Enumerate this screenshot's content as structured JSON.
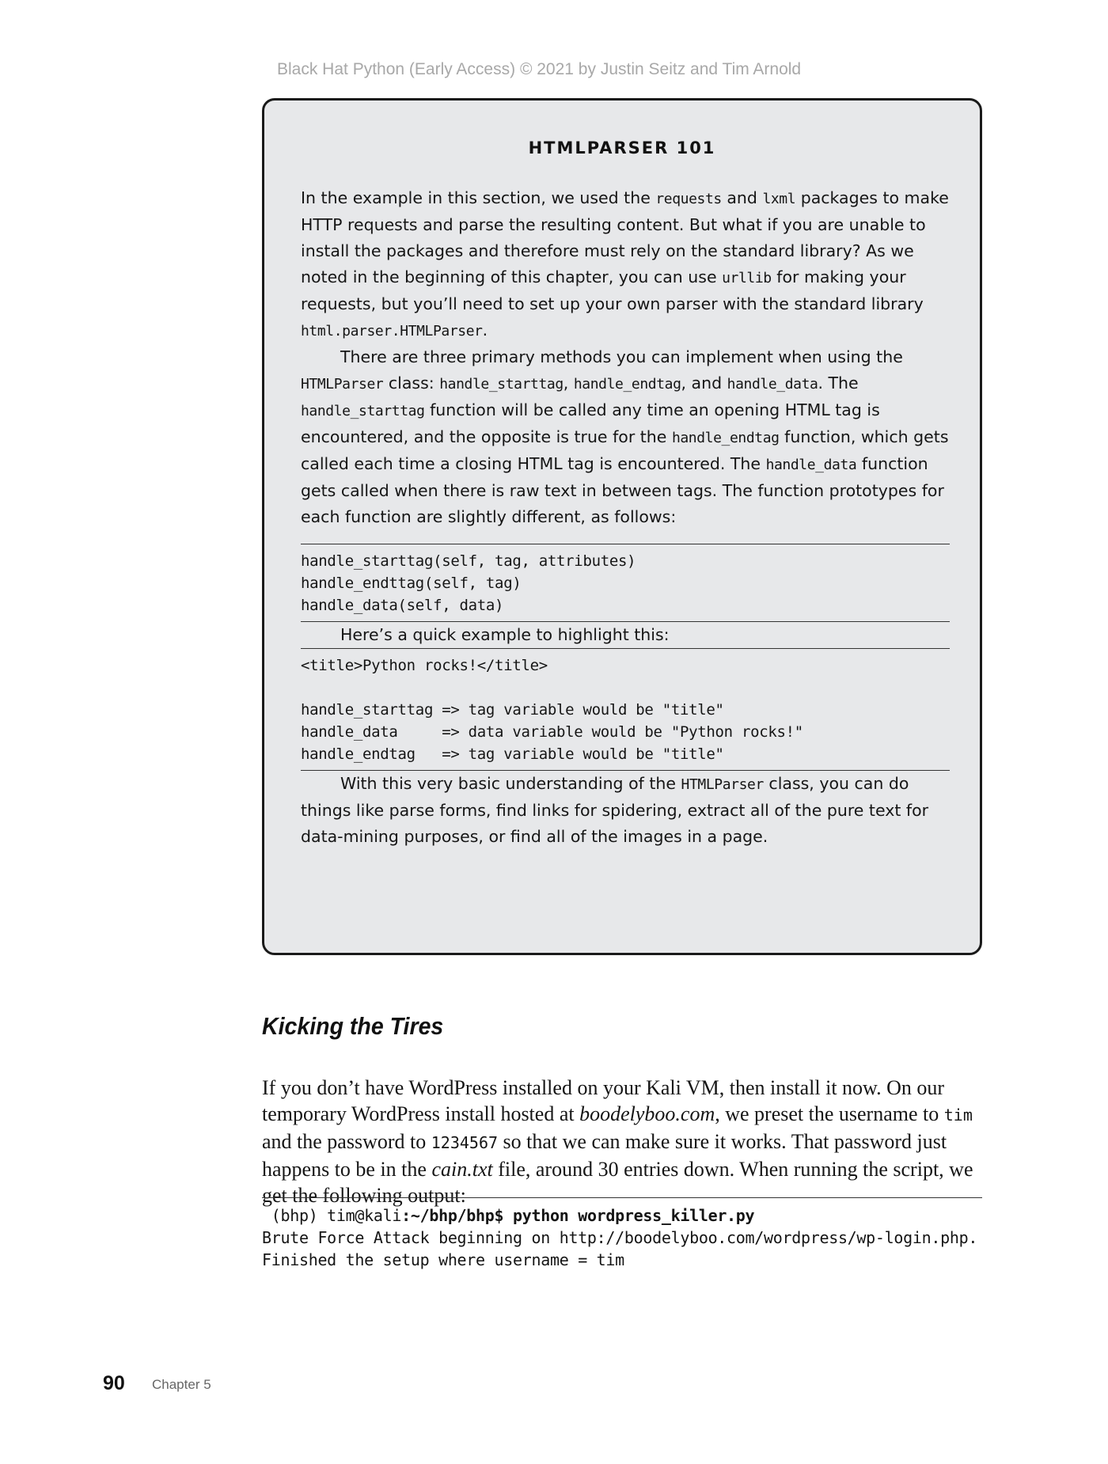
{
  "header": {
    "watermark": "Black Hat Python (Early Access) © 2021 by Justin Seitz and Tim Arnold"
  },
  "sidebar": {
    "title": "HTMLPARSER 101",
    "p1": {
      "t1": "In the example in this section, we used the ",
      "c1": "requests",
      "t2": " and ",
      "c2": "lxml",
      "t3": " packages to make HTTP requests and parse the resulting content. But what if you are unable to install the packages and therefore must rely on the standard library? As we noted in the beginning of this chapter, you can use ",
      "c3": "urllib",
      "t4": " for making your requests, but you’ll need to set up your own parser with the standard library ",
      "c4": "html.parser.HTMLParser",
      "t5": "."
    },
    "p2": {
      "t1": "There are three primary methods you can implement when using the ",
      "c1": "HTMLParser",
      "t2": " class: ",
      "c2": "handle_starttag",
      "t3": ", ",
      "c3": "handle_endtag",
      "t4": ", and ",
      "c4": "handle_data",
      "t5": ". The ",
      "c5": "handle_starttag",
      "t6": " function will be called any time an opening HTML tag is encountered, and the opposite is true for the ",
      "c6": "handle_endtag",
      "t7": " function, which gets called each time a closing HTML tag is encountered. The ",
      "c7": "handle_data",
      "t8": " function gets called when there is raw text in between tags. The function prototypes for each function are slightly different, as follows:"
    },
    "code1": "handle_starttag(self, tag, attributes)\nhandle_endttag(self, tag)\nhandle_data(self, data)",
    "p3": "Here’s a quick example to highlight this:",
    "code2": "<title>Python rocks!</title>\n\nhandle_starttag => tag variable would be \"title\"\nhandle_data     => data variable would be \"Python rocks!\"\nhandle_endtag   => tag variable would be \"title\"",
    "p4": {
      "t1": "With this very basic understanding of the ",
      "c1": "HTMLParser",
      "t2": " class, you can do things like parse forms, find links for spidering, extract all of the pure text for data-mining purposes, or find all of the images in a page."
    }
  },
  "section": {
    "heading": "Kicking the Tires",
    "para": {
      "t1": "If you don’t have WordPress installed on your Kali VM, then install it now. On our temporary WordPress install hosted at ",
      "e1": "boodelyboo.com",
      "t2": ", we preset the username to ",
      "c1": "tim",
      "t3": " and the password to ",
      "c2": "1234567",
      "t4": " so that we can make sure it works. That password just happens to be in the ",
      "e2": "cain.txt",
      "t5": " file, around 30 entries down. When running the script, we get the following output:"
    },
    "output": {
      "prompt_prefix": " (bhp) tim@kali",
      "prompt_bold": ":~/bhp/bhp$ python wordpress_killer.py",
      "lines": "Brute Force Attack beginning on http://boodelyboo.com/wordpress/wp-login.php.\nFinished the setup where username = tim"
    }
  },
  "footer": {
    "page_number": "90",
    "chapter": "Chapter 5"
  }
}
